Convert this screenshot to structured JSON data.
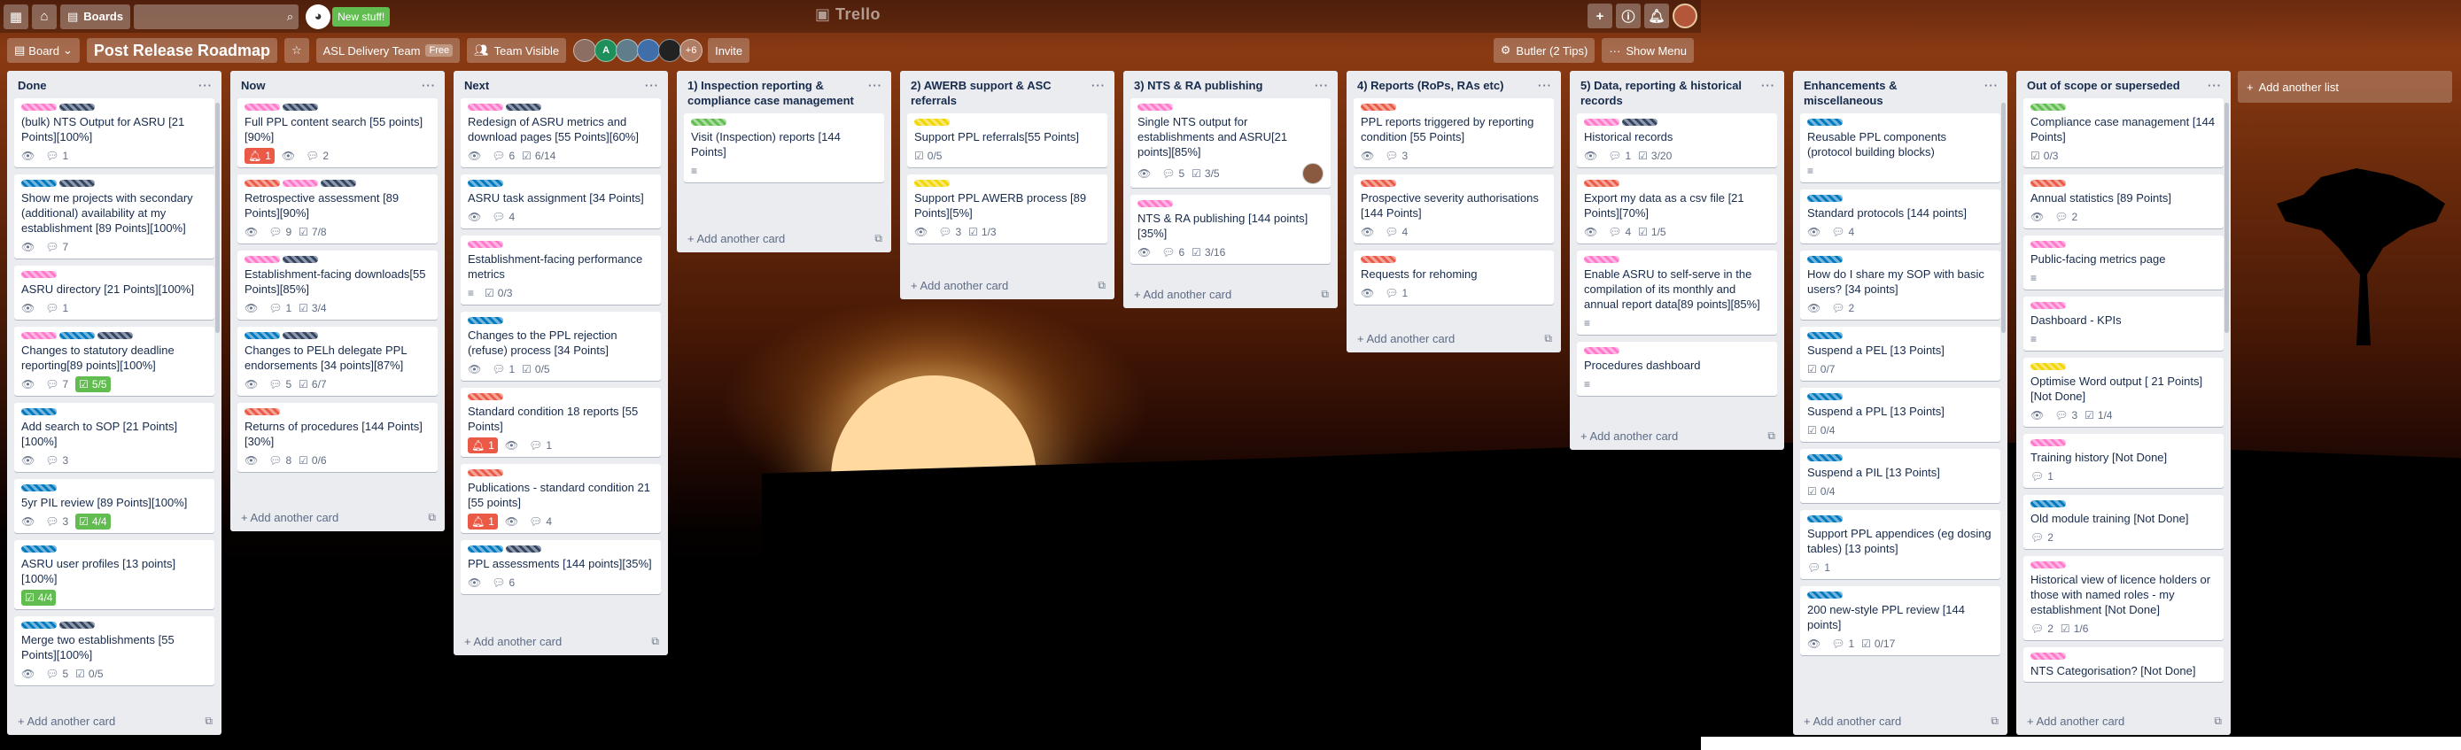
{
  "header": {
    "boards_label": "Boards",
    "search_placeholder": "",
    "new_stuff": "New stuff!",
    "logo": "Trello"
  },
  "board": {
    "view_label": "Board",
    "title": "Post Release Roadmap",
    "team": "ASL Delivery Team",
    "team_plan": "Free",
    "visibility": "Team Visible",
    "members_extra": "+6",
    "invite": "Invite",
    "butler": "Butler (2 Tips)",
    "show_menu": "Show Menu"
  },
  "add_card_label": "Add another card",
  "add_list_label": "Add another list",
  "lists": [
    {
      "title": "Done",
      "cards": [
        {
          "labels": [
            "pink",
            "dark"
          ],
          "title": "(bulk) NTS Output for ASRU [21 Points][100%]",
          "badges": [
            {
              "t": "watch"
            },
            {
              "t": "comments",
              "v": "1"
            }
          ]
        },
        {
          "labels": [
            "blue",
            "dark"
          ],
          "title": "Show me projects with secondary (additional) availability at my establishment [89 Points][100%]",
          "badges": [
            {
              "t": "watch"
            },
            {
              "t": "comments",
              "v": "7"
            }
          ]
        },
        {
          "labels": [
            "pink"
          ],
          "title": "ASRU directory [21 Points][100%]",
          "badges": [
            {
              "t": "watch"
            },
            {
              "t": "comments",
              "v": "1"
            }
          ]
        },
        {
          "labels": [
            "pink",
            "blue",
            "dark"
          ],
          "title": "Changes to statutory deadline reporting[89 points][100%]",
          "badges": [
            {
              "t": "watch"
            },
            {
              "t": "comments",
              "v": "7"
            },
            {
              "t": "check-done",
              "v": "5/5"
            }
          ]
        },
        {
          "labels": [
            "blue"
          ],
          "title": "Add search to SOP [21 Points][100%]",
          "badges": [
            {
              "t": "watch"
            },
            {
              "t": "comments",
              "v": "3"
            }
          ]
        },
        {
          "labels": [
            "blue"
          ],
          "title": "5yr PIL review [89 Points][100%]",
          "badges": [
            {
              "t": "watch"
            },
            {
              "t": "comments",
              "v": "3"
            },
            {
              "t": "check-done",
              "v": "4/4"
            }
          ]
        },
        {
          "labels": [
            "blue"
          ],
          "title": "ASRU user profiles [13 points][100%]",
          "badges": [
            {
              "t": "check-done",
              "v": "4/4"
            }
          ]
        },
        {
          "labels": [
            "blue",
            "dark"
          ],
          "title": "Merge two establishments [55 Points][100%]",
          "badges": [
            {
              "t": "watch"
            },
            {
              "t": "comments",
              "v": "5"
            },
            {
              "t": "check",
              "v": "0/5"
            }
          ]
        }
      ]
    },
    {
      "title": "Now",
      "cards": [
        {
          "labels": [
            "pink",
            "dark"
          ],
          "title": "Full PPL content search [55 points][90%]",
          "badges": [
            {
              "t": "alert",
              "v": "1"
            },
            {
              "t": "watch"
            },
            {
              "t": "comments",
              "v": "2"
            }
          ]
        },
        {
          "labels": [
            "red",
            "pink",
            "dark"
          ],
          "title": "Retrospective assessment [89 Points][90%]",
          "badges": [
            {
              "t": "watch"
            },
            {
              "t": "comments",
              "v": "9"
            },
            {
              "t": "check",
              "v": "7/8"
            }
          ]
        },
        {
          "labels": [
            "pink",
            "dark"
          ],
          "title": "Establishment-facing downloads[55 Points][85%]",
          "badges": [
            {
              "t": "watch"
            },
            {
              "t": "comments",
              "v": "1"
            },
            {
              "t": "check",
              "v": "3/4"
            }
          ]
        },
        {
          "labels": [
            "blue",
            "dark"
          ],
          "title": "Changes to PELh delegate PPL endorsements [34 points][87%]",
          "badges": [
            {
              "t": "watch"
            },
            {
              "t": "comments",
              "v": "5"
            },
            {
              "t": "check",
              "v": "6/7"
            }
          ]
        },
        {
          "labels": [
            "red"
          ],
          "title": "Returns of procedures [144 Points][30%]",
          "badges": [
            {
              "t": "watch"
            },
            {
              "t": "comments",
              "v": "8"
            },
            {
              "t": "check",
              "v": "0/6"
            }
          ]
        }
      ]
    },
    {
      "title": "Next",
      "cards": [
        {
          "labels": [
            "pink",
            "dark"
          ],
          "title": "Redesign of ASRU metrics and download pages [55 Points][60%]",
          "badges": [
            {
              "t": "watch"
            },
            {
              "t": "comments",
              "v": "6"
            },
            {
              "t": "check",
              "v": "6/14"
            }
          ]
        },
        {
          "labels": [
            "blue"
          ],
          "title": "ASRU task assignment [34 Points]",
          "badges": [
            {
              "t": "watch"
            },
            {
              "t": "comments",
              "v": "4"
            }
          ]
        },
        {
          "labels": [
            "pink"
          ],
          "title": "Establishment-facing performance metrics",
          "badges": [
            {
              "t": "desc"
            },
            {
              "t": "check",
              "v": "0/3"
            }
          ]
        },
        {
          "labels": [
            "blue"
          ],
          "title": "Changes to the PPL rejection (refuse) process [34 Points]",
          "badges": [
            {
              "t": "watch"
            },
            {
              "t": "comments",
              "v": "1"
            },
            {
              "t": "check",
              "v": "0/5"
            }
          ]
        },
        {
          "labels": [
            "red"
          ],
          "title": "Standard condition 18 reports [55 Points]",
          "badges": [
            {
              "t": "alert",
              "v": "1"
            },
            {
              "t": "watch"
            },
            {
              "t": "comments",
              "v": "1"
            }
          ]
        },
        {
          "labels": [
            "red"
          ],
          "title": "Publications - standard condition 21 [55 points]",
          "badges": [
            {
              "t": "alert",
              "v": "1"
            },
            {
              "t": "watch"
            },
            {
              "t": "comments",
              "v": "4"
            }
          ]
        },
        {
          "labels": [
            "blue",
            "dark"
          ],
          "title": "PPL assessments [144 points][35%]",
          "badges": [
            {
              "t": "watch"
            },
            {
              "t": "comments",
              "v": "6"
            }
          ]
        }
      ]
    },
    {
      "title": "1) Inspection reporting & compliance case management",
      "cards": [
        {
          "labels": [
            "green"
          ],
          "title": "Visit (Inspection) reports [144 Points]",
          "badges": [
            {
              "t": "desc"
            }
          ]
        }
      ]
    },
    {
      "title": "2) AWERB support & ASC referrals",
      "cards": [
        {
          "labels": [
            "yellow"
          ],
          "title": "Support PPL referrals[55 Points]",
          "badges": [
            {
              "t": "check",
              "v": "0/5"
            }
          ]
        },
        {
          "labels": [
            "yellow"
          ],
          "title": "Support PPL AWERB process [89 Points][5%]",
          "badges": [
            {
              "t": "watch"
            },
            {
              "t": "comments",
              "v": "3"
            },
            {
              "t": "check",
              "v": "1/3"
            }
          ]
        }
      ]
    },
    {
      "title": "3) NTS & RA publishing",
      "cards": [
        {
          "labels": [
            "pink"
          ],
          "title": "Single NTS output for establishments and ASRU[21 points][85%]",
          "badges": [
            {
              "t": "watch"
            },
            {
              "t": "comments",
              "v": "5"
            },
            {
              "t": "check",
              "v": "3/5"
            },
            {
              "t": "avatar"
            }
          ]
        },
        {
          "labels": [
            "pink"
          ],
          "title": "NTS & RA publishing [144 points][35%]",
          "badges": [
            {
              "t": "watch"
            },
            {
              "t": "comments",
              "v": "6"
            },
            {
              "t": "check",
              "v": "3/16"
            }
          ]
        }
      ]
    },
    {
      "title": "4) Reports (RoPs, RAs etc)",
      "cards": [
        {
          "labels": [
            "red"
          ],
          "title": "PPL reports triggered by reporting condition [55 Points]",
          "badges": [
            {
              "t": "watch"
            },
            {
              "t": "comments",
              "v": "3"
            }
          ]
        },
        {
          "labels": [
            "red"
          ],
          "title": "Prospective severity authorisations [144 Points]",
          "badges": [
            {
              "t": "watch"
            },
            {
              "t": "comments",
              "v": "4"
            }
          ]
        },
        {
          "labels": [
            "red"
          ],
          "title": "Requests for rehoming",
          "badges": [
            {
              "t": "watch"
            },
            {
              "t": "comments",
              "v": "1"
            }
          ]
        }
      ]
    },
    {
      "title": "5) Data, reporting & historical records",
      "cards": [
        {
          "labels": [
            "pink",
            "dark"
          ],
          "title": "Historical records",
          "badges": [
            {
              "t": "watch"
            },
            {
              "t": "comments",
              "v": "1"
            },
            {
              "t": "check",
              "v": "3/20"
            }
          ]
        },
        {
          "labels": [
            "red"
          ],
          "title": "Export my data as a csv file [21 Points][70%]",
          "badges": [
            {
              "t": "watch"
            },
            {
              "t": "comments",
              "v": "4"
            },
            {
              "t": "check",
              "v": "1/5"
            }
          ]
        },
        {
          "labels": [
            "pink"
          ],
          "title": "Enable ASRU to self-serve in the compilation of its monthly and annual report data[89 points][85%]",
          "badges": [
            {
              "t": "desc"
            }
          ]
        },
        {
          "labels": [
            "pink"
          ],
          "title": "Procedures dashboard",
          "badges": [
            {
              "t": "desc"
            }
          ]
        }
      ]
    },
    {
      "title": "Enhancements & miscellaneous",
      "cards": [
        {
          "labels": [
            "blue"
          ],
          "title": "Reusable PPL components (protocol building blocks)",
          "badges": [
            {
              "t": "desc"
            }
          ]
        },
        {
          "labels": [
            "blue"
          ],
          "title": "Standard protocols [144 points]",
          "badges": [
            {
              "t": "watch"
            },
            {
              "t": "comments",
              "v": "4"
            }
          ]
        },
        {
          "labels": [
            "blue"
          ],
          "title": "How do I share my SOP with basic users? [34 points]",
          "badges": [
            {
              "t": "watch"
            },
            {
              "t": "comments",
              "v": "2"
            }
          ]
        },
        {
          "labels": [
            "blue"
          ],
          "title": "Suspend a PEL [13 Points]",
          "badges": [
            {
              "t": "check",
              "v": "0/7"
            }
          ]
        },
        {
          "labels": [
            "blue"
          ],
          "title": "Suspend a PPL [13 Points]",
          "badges": [
            {
              "t": "check",
              "v": "0/4"
            }
          ]
        },
        {
          "labels": [
            "blue"
          ],
          "title": "Suspend a PIL [13 Points]",
          "badges": [
            {
              "t": "check",
              "v": "0/4"
            }
          ]
        },
        {
          "labels": [
            "blue"
          ],
          "title": "Support PPL appendices (eg dosing tables) [13 points]",
          "badges": [
            {
              "t": "comments",
              "v": "1"
            }
          ]
        },
        {
          "labels": [
            "blue"
          ],
          "title": "200 new-style PPL review [144 points]",
          "badges": [
            {
              "t": "watch"
            },
            {
              "t": "comments",
              "v": "1"
            },
            {
              "t": "check",
              "v": "0/17"
            }
          ]
        }
      ]
    },
    {
      "title": "Out of scope or superseded",
      "cards": [
        {
          "labels": [
            "green"
          ],
          "title": "Compliance case management [144 Points]",
          "badges": [
            {
              "t": "check",
              "v": "0/3"
            }
          ]
        },
        {
          "labels": [
            "red"
          ],
          "title": "Annual statistics [89 Points]",
          "badges": [
            {
              "t": "watch"
            },
            {
              "t": "comments",
              "v": "2"
            }
          ]
        },
        {
          "labels": [
            "pink"
          ],
          "title": "Public-facing metrics page",
          "badges": [
            {
              "t": "desc"
            }
          ]
        },
        {
          "labels": [
            "pink"
          ],
          "title": "Dashboard - KPIs",
          "badges": [
            {
              "t": "desc"
            }
          ]
        },
        {
          "labels": [
            "yellow"
          ],
          "title": "Optimise Word output [ 21 Points][Not Done]",
          "badges": [
            {
              "t": "watch"
            },
            {
              "t": "comments",
              "v": "3"
            },
            {
              "t": "check",
              "v": "1/4"
            }
          ]
        },
        {
          "labels": [
            "pink"
          ],
          "title": "Training history [Not Done]",
          "badges": [
            {
              "t": "comments",
              "v": "1"
            }
          ]
        },
        {
          "labels": [
            "blue"
          ],
          "title": "Old module training [Not Done]",
          "badges": [
            {
              "t": "comments",
              "v": "2"
            }
          ]
        },
        {
          "labels": [
            "pink"
          ],
          "title": "Historical view of licence holders or those with named roles - my establishment [Not Done]",
          "badges": [
            {
              "t": "comments",
              "v": "2"
            },
            {
              "t": "check",
              "v": "1/6"
            }
          ]
        },
        {
          "labels": [
            "pink"
          ],
          "title": "NTS Categorisation? [Not Done]",
          "badges": []
        }
      ]
    }
  ],
  "colors": {
    "pink": "#ff78cb",
    "dark": "#344563",
    "blue": "#0079bf",
    "red": "#eb5a46",
    "green": "#61bd4f",
    "yellow": "#f2d600"
  },
  "icons": {
    "watch": "eye-icon",
    "comments": "comment-icon",
    "check": "checklist-icon",
    "desc": "description-icon",
    "alert": "alert-icon"
  }
}
